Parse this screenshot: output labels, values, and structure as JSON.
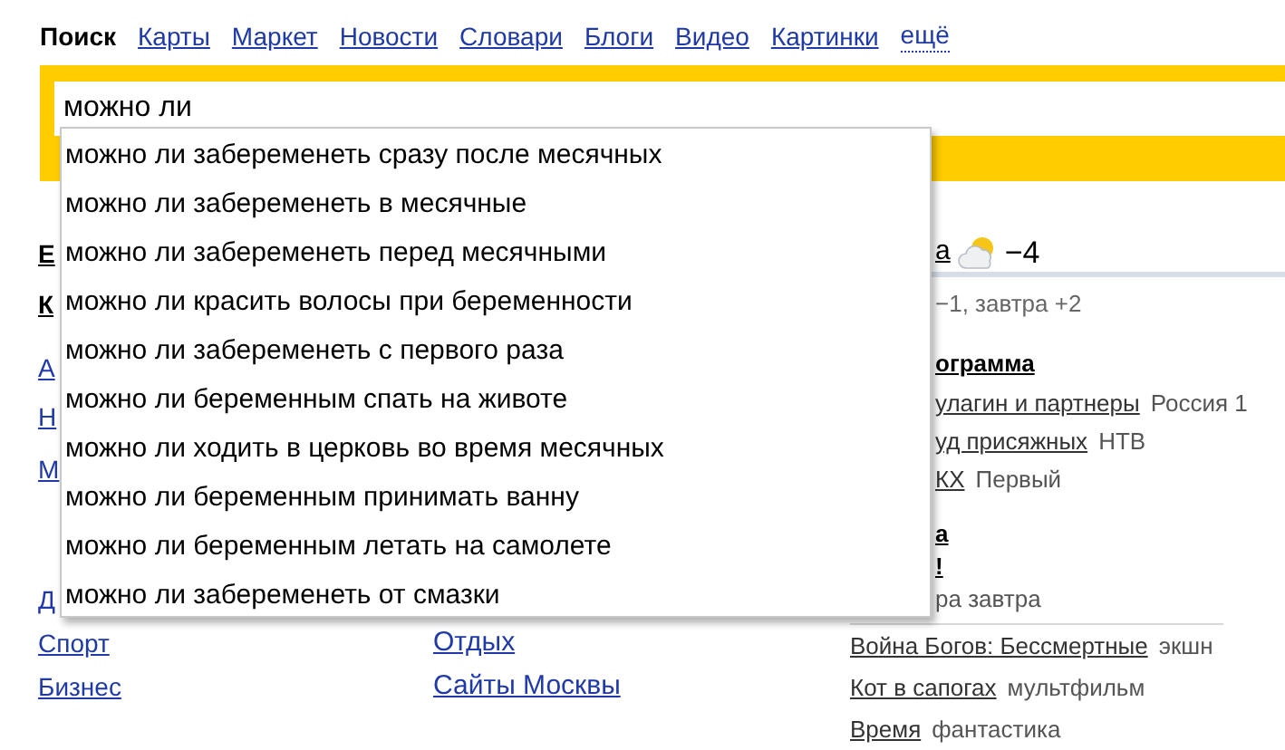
{
  "nav": [
    {
      "label": "Поиск",
      "selected": true,
      "kind": "link"
    },
    {
      "label": "Карты",
      "selected": false,
      "kind": "link"
    },
    {
      "label": "Маркет",
      "selected": false,
      "kind": "link"
    },
    {
      "label": "Новости",
      "selected": false,
      "kind": "link"
    },
    {
      "label": "Словари",
      "selected": false,
      "kind": "link"
    },
    {
      "label": "Блоги",
      "selected": false,
      "kind": "link"
    },
    {
      "label": "Видео",
      "selected": false,
      "kind": "link"
    },
    {
      "label": "Картинки",
      "selected": false,
      "kind": "link"
    },
    {
      "label": "ещё",
      "selected": false,
      "kind": "more"
    }
  ],
  "search": {
    "value": "можно ли"
  },
  "suggestions": [
    "можно ли забеременеть сразу после месячных",
    "можно ли забеременеть в месячные",
    "можно ли забеременеть перед месячными",
    "можно ли красить волосы при беременности",
    "можно ли забеременеть с первого раза",
    "можно ли беременным спать на животе",
    "можно ли ходить в церковь во время месячных",
    "можно ли беременным принимать ванну",
    "можно ли беременным летать на самолете",
    "можно ли забеременеть от смазки"
  ],
  "left_column": [
    {
      "text": "Е",
      "kind": "heading"
    },
    {
      "text": "К",
      "kind": "heading"
    },
    {
      "text": "А",
      "kind": "link"
    },
    {
      "text": "Н",
      "kind": "link"
    },
    {
      "text": "М",
      "kind": "link"
    },
    {
      "text": "Д",
      "kind": "link"
    },
    {
      "text": "Спорт",
      "kind": "link"
    },
    {
      "text": "Бизнес",
      "kind": "link"
    }
  ],
  "middle_column": [
    "Отдых",
    "Сайты Москвы"
  ],
  "weather": {
    "city": "а",
    "temperature": "−4",
    "forecast": "−1, завтра +2"
  },
  "tv": {
    "title": "ограмма",
    "rows": [
      {
        "show": "улагин и партнеры",
        "channel": "Россия 1"
      },
      {
        "show": "уд присяжных",
        "channel": "НТВ"
      },
      {
        "show": "КХ",
        "channel": "Первый"
      }
    ]
  },
  "cinema": {
    "title": "а",
    "subtitle": "!",
    "note": "ра завтра",
    "rows": [
      {
        "film": "Война Богов: Бессмертные",
        "genre": "экшн"
      },
      {
        "film": "Кот в сапогах",
        "genre": "мультфильм"
      },
      {
        "film": "Время",
        "genre": "фантастика"
      }
    ]
  }
}
